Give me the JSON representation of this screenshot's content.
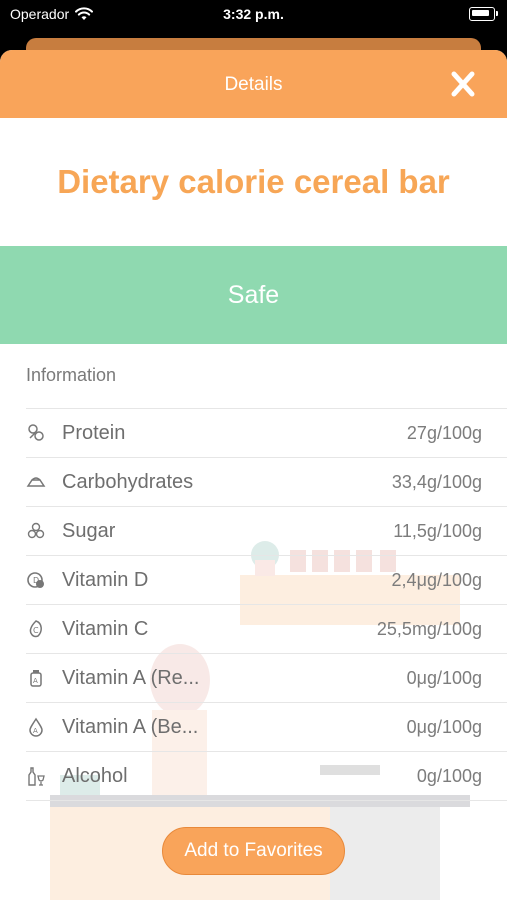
{
  "status_bar": {
    "carrier": "Operador",
    "time": "3:32 p.m."
  },
  "nav": {
    "title": "Details",
    "close_icon": "close-x-icon"
  },
  "product": {
    "name": "Dietary calorie cereal bar"
  },
  "safety": {
    "label": "Safe",
    "color": "#8fd9b0"
  },
  "info": {
    "header": "Information"
  },
  "nutrients": [
    {
      "icon": "protein-icon",
      "label": "Protein",
      "value": "27g/100g"
    },
    {
      "icon": "carbohydrates-icon",
      "label": "Carbohydrates",
      "value": "33,4g/100g"
    },
    {
      "icon": "sugar-icon",
      "label": "Sugar",
      "value": "11,5g/100g"
    },
    {
      "icon": "vitamin-d-icon",
      "label": "Vitamin D",
      "value": "2,4μg/100g"
    },
    {
      "icon": "vitamin-c-icon",
      "label": "Vitamin C",
      "value": "25,5mg/100g"
    },
    {
      "icon": "vitamin-a-retinol-icon",
      "label": "Vitamin A (Re...",
      "value": "0μg/100g"
    },
    {
      "icon": "vitamin-a-beta-icon",
      "label": "Vitamin A (Be...",
      "value": "0μg/100g"
    },
    {
      "icon": "alcohol-icon",
      "label": "Alcohol",
      "value": "0g/100g"
    }
  ],
  "actions": {
    "favorites_label": "Add to Favorites"
  },
  "colors": {
    "accent": "#f9a45a",
    "title": "#f7a656",
    "safe": "#8fd9b0"
  }
}
